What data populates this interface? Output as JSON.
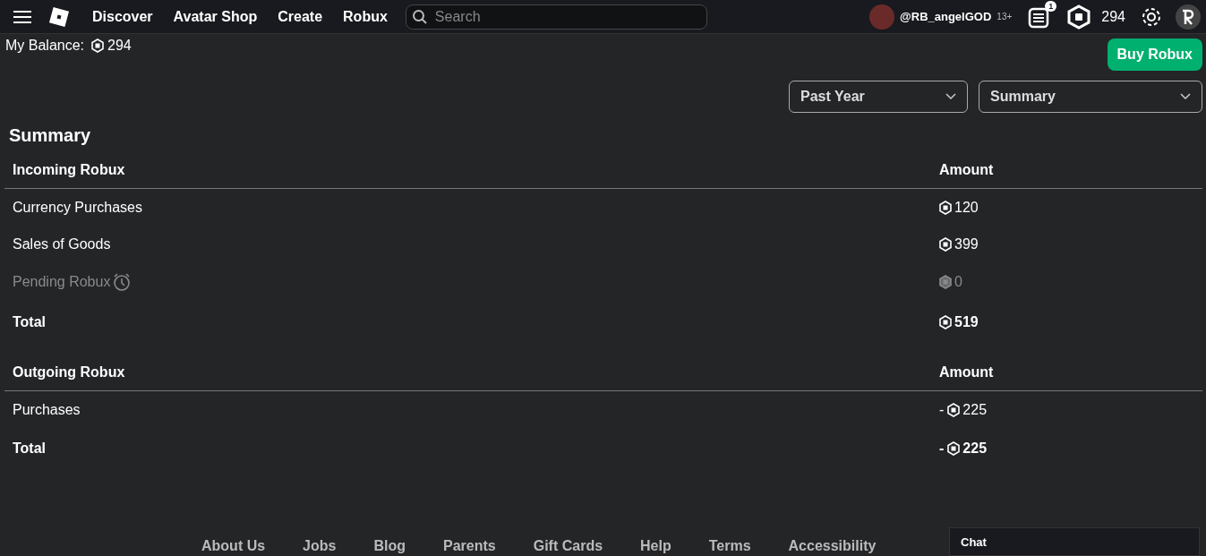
{
  "nav": {
    "links": [
      "Discover",
      "Avatar Shop",
      "Create",
      "Robux"
    ],
    "search": {
      "placeholder": "Search"
    },
    "username": "@RB_angelGOD",
    "age_label": "13+",
    "notification_count": "1",
    "robux": "294"
  },
  "balance": {
    "label": "My Balance:",
    "amount": "294"
  },
  "buy_button": "Buy Robux",
  "filters": [
    "Past Year",
    "Summary"
  ],
  "title": "Summary",
  "sections": [
    {
      "heading": "Incoming Robux",
      "amount_heading": "Amount",
      "rows": [
        {
          "kind": "item",
          "label": "Currency Purchases",
          "sign": "",
          "amount": "120"
        },
        {
          "kind": "item",
          "label": "Sales of Goods",
          "sign": "",
          "amount": "399"
        },
        {
          "kind": "pending",
          "label": "Pending Robux",
          "sign": "",
          "amount": "0"
        },
        {
          "kind": "total",
          "label": "Total",
          "sign": "",
          "amount": "519"
        }
      ]
    },
    {
      "heading": "Outgoing Robux",
      "amount_heading": "Amount",
      "rows": [
        {
          "kind": "item",
          "label": "Purchases",
          "sign": "-",
          "amount": "225"
        },
        {
          "kind": "total",
          "label": "Total",
          "sign": "-",
          "amount": "225"
        }
      ]
    }
  ],
  "footer_links": [
    "About Us",
    "Jobs",
    "Blog",
    "Parents",
    "Gift Cards",
    "Help",
    "Terms",
    "Accessibility"
  ],
  "chat": "Chat"
}
